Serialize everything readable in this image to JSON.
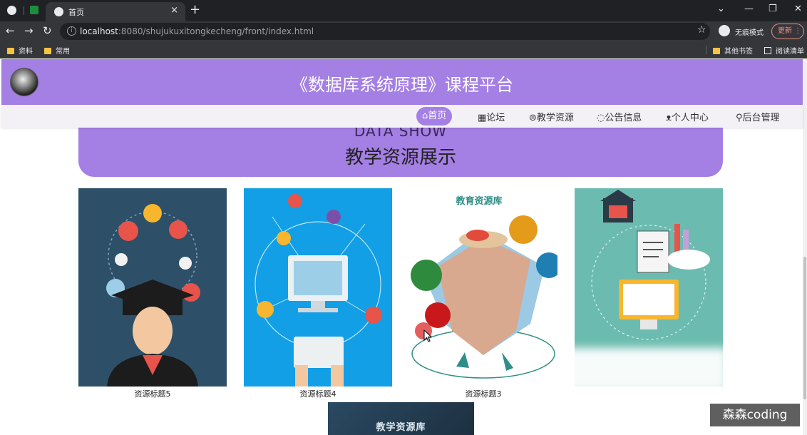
{
  "browser": {
    "tab_title": "首页",
    "tab_close": "×",
    "new_tab": "+",
    "window_controls": [
      "⌄",
      "—",
      "❐",
      "✕"
    ],
    "url_host": "localhost",
    "url_rest": ":8080/shujukuxitongkecheng/front/index.html",
    "incognito_label": "无痕模式",
    "update_label": "更新",
    "bookmarks": [
      "资料",
      "常用"
    ],
    "bookmarks_right": [
      "其他书签",
      "阅读清单"
    ]
  },
  "site": {
    "title": "《数据库系统原理》课程平台"
  },
  "nav": [
    {
      "icon": "⌂",
      "label": "首页"
    },
    {
      "icon": "▦",
      "label": "论坛"
    },
    {
      "icon": "⊜",
      "label": "教学资源"
    },
    {
      "icon": "◌",
      "label": "公告信息"
    },
    {
      "icon": "ᴥ",
      "label": "个人中心"
    },
    {
      "icon": "⚲",
      "label": "后台管理"
    }
  ],
  "section": {
    "title_en": "DATA SHOW",
    "title_cn": "教学资源展示"
  },
  "resources": [
    {
      "label": "资源标题5"
    },
    {
      "label": "资源标题4"
    },
    {
      "label": "资源标题3"
    },
    {
      "label": ""
    }
  ],
  "image_texts": {
    "card3_heading": "教育资源库",
    "bottom_card_heading": "教学资源库"
  },
  "watermark": "森森coding",
  "colors": {
    "accent": "#a47fe4",
    "card1_bg": "#2d5068",
    "card2_bg": "#129fe6",
    "card4_bg": "#6cbbb0"
  }
}
